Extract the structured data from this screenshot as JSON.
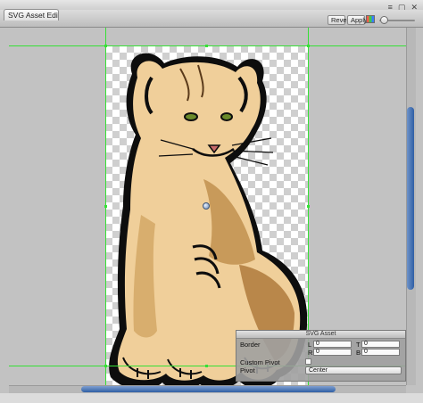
{
  "window": {
    "tab_title": "SVG Asset Editor",
    "controls": [
      "≡",
      "▢",
      "✕"
    ]
  },
  "toolbar": {
    "revert_label": "Revert",
    "apply_label": "Apply",
    "color_toggle_icon": "rgb-channels-icon",
    "zoom_fraction": 0.05
  },
  "canvas": {
    "image_subject": "lion-cub-illustration",
    "guide_color": "#36e036"
  },
  "scroll": {
    "horizontal_fraction": 0.64,
    "vertical_fraction": 0.51
  },
  "svg_asset_panel": {
    "title": "SVG Asset",
    "border_label": "Border",
    "border_fields": [
      {
        "key": "L",
        "value": "0"
      },
      {
        "key": "T",
        "value": "0"
      },
      {
        "key": "R",
        "value": "0"
      },
      {
        "key": "B",
        "value": "0"
      }
    ],
    "custom_pivot_label": "Custom Pivot",
    "custom_pivot_checked": false,
    "pivot_label": "Pivot",
    "pivot_value": "Center"
  }
}
